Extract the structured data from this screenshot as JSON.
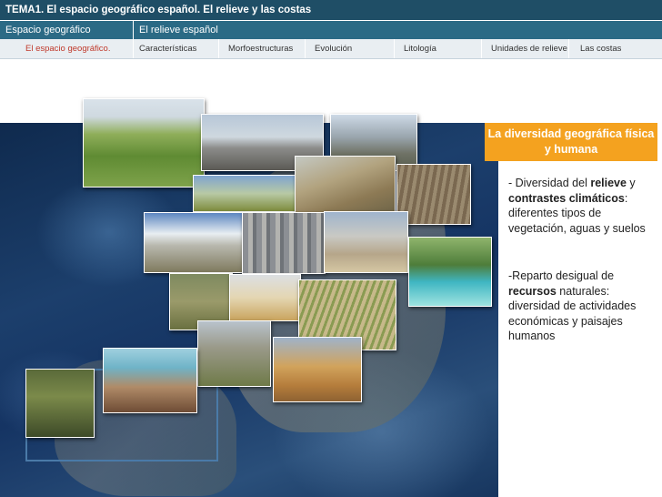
{
  "header": {
    "title": "TEMA1. El espacio geográfico español. El relieve y las costas",
    "sections": [
      "Espacio geográfico",
      "El relieve español"
    ],
    "tabs": [
      {
        "label": "El espacio geográfico.",
        "active": true
      },
      {
        "label": "Características",
        "active": false
      },
      {
        "label": "Morfoestructuras",
        "active": false
      },
      {
        "label": "Evolución",
        "active": false
      },
      {
        "label": "Litología",
        "active": false
      },
      {
        "label": "Unidades de relieve",
        "active": false
      },
      {
        "label": "Las costas",
        "active": false
      }
    ]
  },
  "content": {
    "highlight_title": "La diversidad geográfica física y humana",
    "point1": {
      "prefix": "- Diversidad del ",
      "bold1": "relieve",
      "mid": " y ",
      "bold2": "contrastes climáticos",
      "suffix": ": diferentes tipos de vegetación, aguas y suelos"
    },
    "point2": {
      "prefix": "-Reparto desigual de ",
      "bold1": "recursos",
      "suffix": " naturales: diversidad de actividades económicas y paisajes humanos"
    }
  },
  "colors": {
    "title_bar": "#1f4e66",
    "section_bar": "#2b6a85",
    "tab_bar": "#e9eef2",
    "active_tab": "#c0392b",
    "highlight": "#f4a21f"
  }
}
